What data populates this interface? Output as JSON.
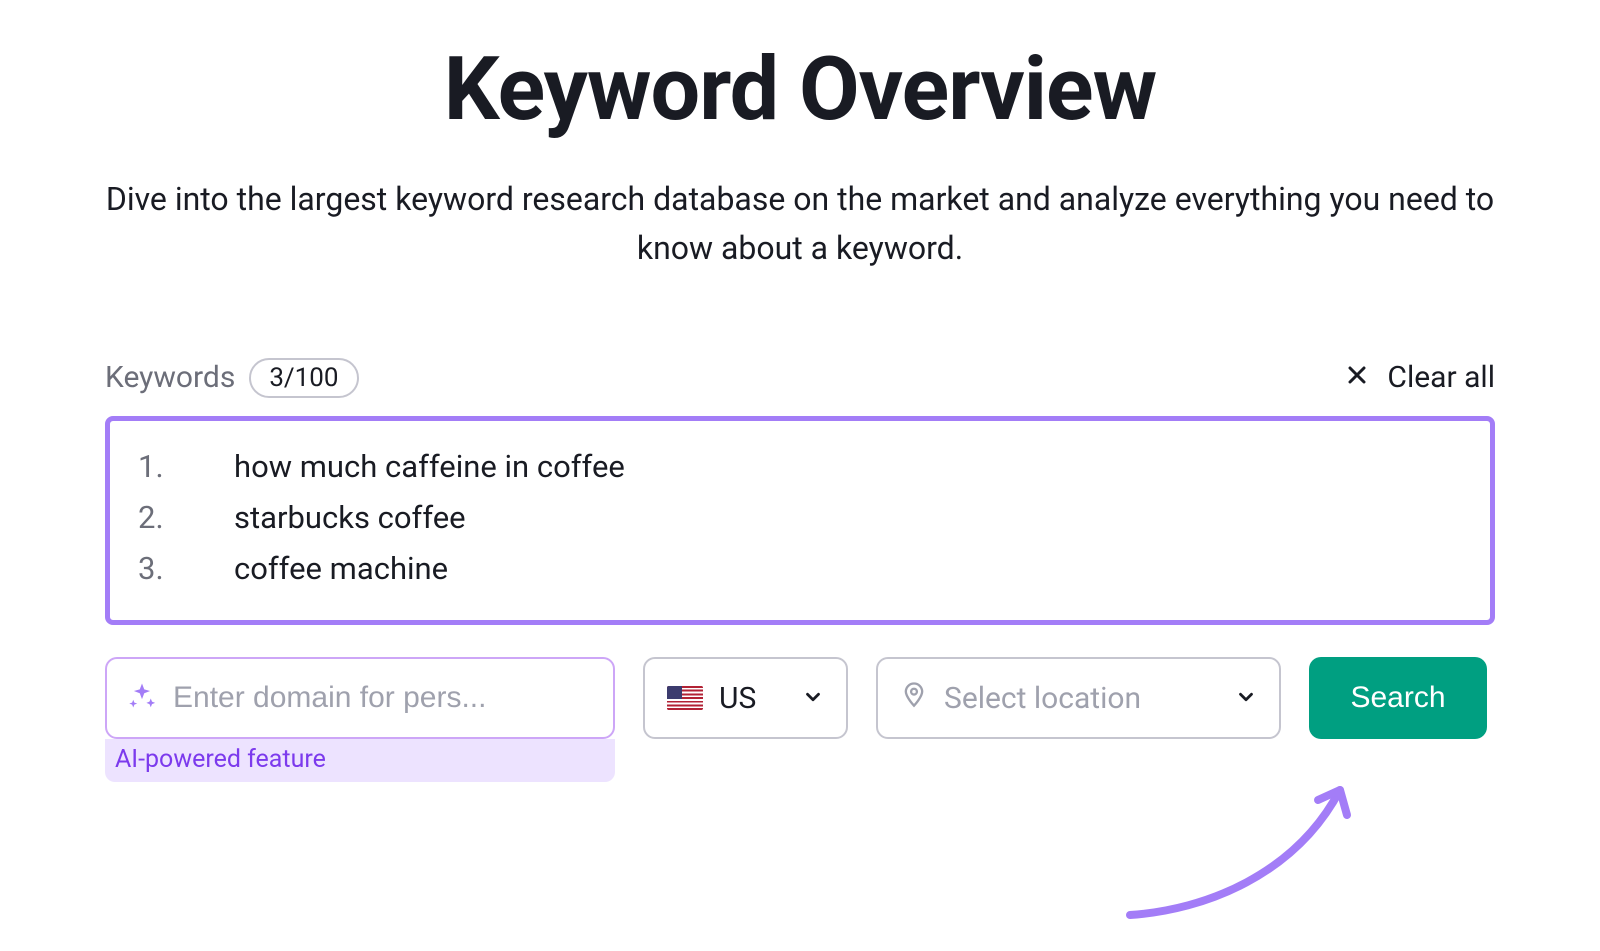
{
  "header": {
    "title": "Keyword Overview",
    "subtitle": "Dive into the largest keyword research database on the market and analyze everything you need to know about a keyword."
  },
  "keywords": {
    "label": "Keywords",
    "count_text": "3/100",
    "clear_label": "Clear all",
    "items": [
      "how much caffeine in coffee",
      "starbucks coffee",
      "coffee machine"
    ]
  },
  "controls": {
    "domain_placeholder": "Enter domain for pers...",
    "ai_label": "AI-powered feature",
    "country_code": "US",
    "location_placeholder": "Select location",
    "search_label": "Search"
  }
}
